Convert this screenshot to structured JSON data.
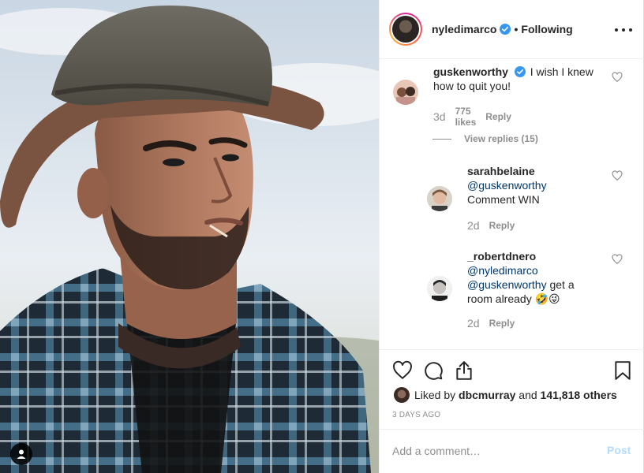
{
  "post": {
    "author": "nyledimarco",
    "follow_status": "Following",
    "separator": "•"
  },
  "comments": [
    {
      "user": "guskenworthy",
      "verified": true,
      "text": "I wish I knew how to quit you!",
      "time": "3d",
      "likes": "775 likes",
      "reply": "Reply"
    }
  ],
  "view_replies": "View replies (15)",
  "replies": [
    {
      "user": "sarahbelaine",
      "mentions": [
        "@guskenworthy"
      ],
      "text": "Comment WIN",
      "time": "2d",
      "reply": "Reply"
    },
    {
      "user": "_robertdnero",
      "mentions": [
        "@nyledimarco",
        "@guskenworthy"
      ],
      "text_after_mention": "get a",
      "text_line2": "room already",
      "emoji": [
        "🤣",
        "😜"
      ],
      "time": "2d",
      "reply": "Reply"
    }
  ],
  "likes_row": {
    "prefix": "Liked by",
    "liker": "dbcmurray",
    "and": "and",
    "others": "141,818 others"
  },
  "time_ago": "3 DAYS AGO",
  "add_comment": {
    "placeholder": "Add a comment…",
    "post_label": "Post"
  },
  "icons": {
    "user_tag": "user-icon",
    "more": "more-options-icon",
    "like": "heart-icon",
    "comment": "comment-icon",
    "share": "share-icon",
    "save": "bookmark-icon"
  },
  "colors": {
    "verified": "#3897f0",
    "mention": "#00376b",
    "post_disabled": "#b3dbff",
    "muted": "#8e8e8e",
    "text": "#262626"
  }
}
